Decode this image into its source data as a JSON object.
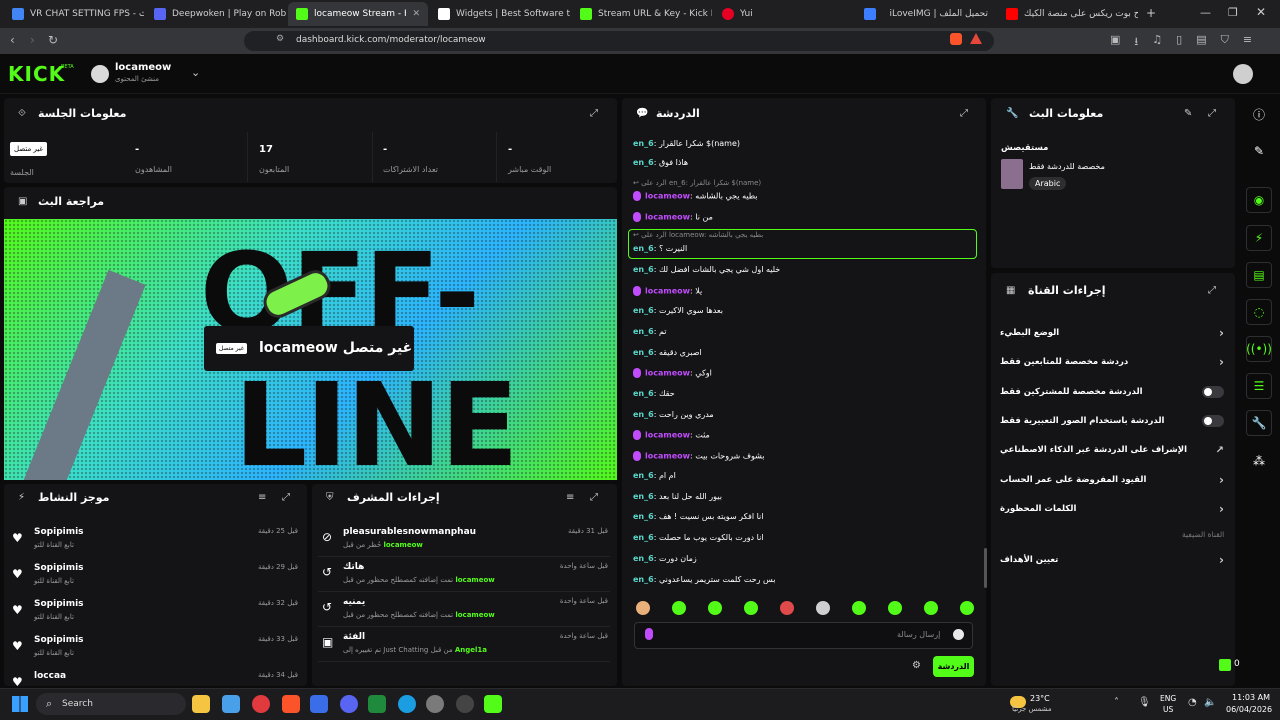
{
  "browser": {
    "tabs": [
      {
        "title": "VR CHAT SETTING FPS - بحث G",
        "color": "#4285f4"
      },
      {
        "title": "Deepwoken | Play on Roblox",
        "color": "#5865f2"
      },
      {
        "title": "locameow Stream - Kick Da",
        "color": "#53fc18"
      },
      {
        "title": "Widgets | Best Software to Enh",
        "color": "#ffffff"
      },
      {
        "title": "Stream URL & Key - Kick Dashb",
        "color": "#53fc18"
      },
      {
        "title": "Yui",
        "color": "#e60023"
      },
      {
        "title": "iLoveIMG | تحميل الملف",
        "color": "#3d7eff"
      },
      {
        "title": "شرح بوت ريكس على منصة الكيك",
        "color": "#ff0000"
      }
    ],
    "url": "dashboard.kick.com/moderator/locameow"
  },
  "header": {
    "logo": "KICK",
    "logo_badge": "BETA",
    "channel_name": "locameow",
    "channel_role": "منشئ المحتوى"
  },
  "session": {
    "title": "معلومات الجلسة",
    "stats": [
      {
        "value": "غير متصل",
        "label": "الجلسة"
      },
      {
        "value": "-",
        "label": "المشاهدون"
      },
      {
        "value": "17",
        "label": "المتابعون"
      },
      {
        "value": "-",
        "label": "تعداد الاشتراكات"
      },
      {
        "value": "-",
        "label": "الوقت مباشر"
      }
    ]
  },
  "preview": {
    "title": "مراجعة البث",
    "offline_text": "غير متصل",
    "offline_badge": "غير متصل",
    "channel": "locameow",
    "bg_word_top": "OFF-",
    "bg_word_bottom": "LINE"
  },
  "activity": {
    "title": "موجز النشاط",
    "items": [
      {
        "user": "Sopipimis",
        "desc": "تابع القناة للتو",
        "time": "قبل 25 دقيقة"
      },
      {
        "user": "Sopipimis",
        "desc": "تابع القناة للتو",
        "time": "قبل 29 دقيقة"
      },
      {
        "user": "Sopipimis",
        "desc": "تابع القناة للتو",
        "time": "قبل 32 دقيقة"
      },
      {
        "user": "Sopipimis",
        "desc": "تابع القناة للتو",
        "time": "قبل 33 دقيقة"
      },
      {
        "user": "loccaa",
        "desc": "",
        "time": "قبل 34 دقيقة"
      }
    ]
  },
  "modactions": {
    "title": "إجراءات المشرف",
    "items": [
      {
        "title": "pleasurablesnowmanphau",
        "desc_pre": "حُظر من قبل",
        "desc_user": "locameow",
        "time": "قبل 31 دقيقة"
      },
      {
        "title": "هاتك",
        "desc_pre": "تمت إضافته كمصطلح محظور من قبل",
        "desc_user": "locameow",
        "time": "قبل ساعة واحدة"
      },
      {
        "title": "يمنيه",
        "desc_pre": "تمت إضافته كمصطلح محظور من قبل",
        "desc_user": "locameow",
        "time": "قبل ساعة واحدة"
      },
      {
        "title": "الفئة",
        "desc_pre": "تم تغييره إلى Just Chatting من قبل",
        "desc_user": "Angel1a",
        "time": "قبل ساعة واحدة"
      }
    ]
  },
  "chat": {
    "title": "الدردشة",
    "messages": [
      {
        "user": "en_6",
        "text": "شكرا عالقرار $(name)",
        "mod": false
      },
      {
        "user": "en_6",
        "text": "هاذا فوق",
        "mod": false
      },
      {
        "user": "",
        "text": "الرد على en_6: شكرا عالقرار $(name)",
        "mod": false,
        "reply": true
      },
      {
        "user": "locameow",
        "text": "بطيه يجي بالشاشه",
        "mod": true
      },
      {
        "user": "locameow",
        "text": "من نا",
        "mod": true
      },
      {
        "user": "",
        "text": "الرد على locameow: بطيه يجي بالشاشه",
        "mod": false,
        "reply": true
      },
      {
        "user": "en_6",
        "text": "النيرت ؟",
        "mod": false,
        "highlight": true
      },
      {
        "user": "en_6",
        "text": "خليه اول شي يجي بالشات افضل لك",
        "mod": false
      },
      {
        "user": "locameow",
        "text": "يلا",
        "mod": true
      },
      {
        "user": "en_6",
        "text": "بعدها سوي الاكيرت",
        "mod": false
      },
      {
        "user": "en_6",
        "text": "تم",
        "mod": false
      },
      {
        "user": "en_6",
        "text": "اصبري دقيقه",
        "mod": false
      },
      {
        "user": "locameow",
        "text": "اوكي",
        "mod": true
      },
      {
        "user": "en_6",
        "text": "حقك",
        "mod": false
      },
      {
        "user": "en_6",
        "text": "مدري وين راحت",
        "mod": false
      },
      {
        "user": "locameow",
        "text": "مثت",
        "mod": true
      },
      {
        "user": "locameow",
        "text": "بشوف شروحات بيت",
        "mod": true
      },
      {
        "user": "en_6",
        "text": "ام ام",
        "mod": false
      },
      {
        "user": "en_6",
        "text": "بيور الله حل لنا بعد",
        "mod": false
      },
      {
        "user": "en_6",
        "text": "انا افكر سويته بس نسيت ! هف",
        "mod": false
      },
      {
        "user": "en_6",
        "text": "انا دورت بالكوت يوب ما حصلت",
        "mod": false
      },
      {
        "user": "en_6",
        "text": "زمان دورت",
        "mod": false
      },
      {
        "user": "en_6",
        "text": "بس رحت كلمت ستريمر يساعدوني",
        "mod": false
      }
    ],
    "input_placeholder": "إرسال رسالة",
    "send_label": "الدردشة"
  },
  "streaminfo": {
    "title": "معلومات البث",
    "stream_title": "مستقيصش",
    "category": "مخصصة للدردشة فقط",
    "language": "Arabic"
  },
  "channelactions": {
    "title": "إجراءات القناة",
    "items": [
      {
        "label": "الوضع البطيء",
        "control": "chevron"
      },
      {
        "label": "دردشة مخصصة للمتابعين فقط",
        "control": "chevron"
      },
      {
        "label": "الدردشة مخصصة للمشتركين فقط",
        "control": "toggle"
      },
      {
        "label": "الدردشة باستخدام الصور التعبيرية فقط",
        "control": "toggle"
      },
      {
        "label": "الإشراف على الدردشة عبر الذكاء الاصطناعي",
        "control": "link"
      },
      {
        "label": "القيود المفروضة على عمر الحساب",
        "control": "chevron"
      },
      {
        "label": "الكلمات المحظورة",
        "control": "chevron"
      }
    ],
    "section_label": "القناة الضيفية",
    "host_label": "تعيين الأهداف"
  },
  "taskbar": {
    "search": "Search",
    "weather_temp": "23°C",
    "weather_desc": "مشمس جزئيًا",
    "lang_top": "ENG",
    "lang_bottom": "US",
    "time": "11:03 AM",
    "date": "06/04/2026"
  },
  "colors": {
    "accent": "#53fc18",
    "mod": "#c04cfd",
    "panel": "#141416"
  }
}
